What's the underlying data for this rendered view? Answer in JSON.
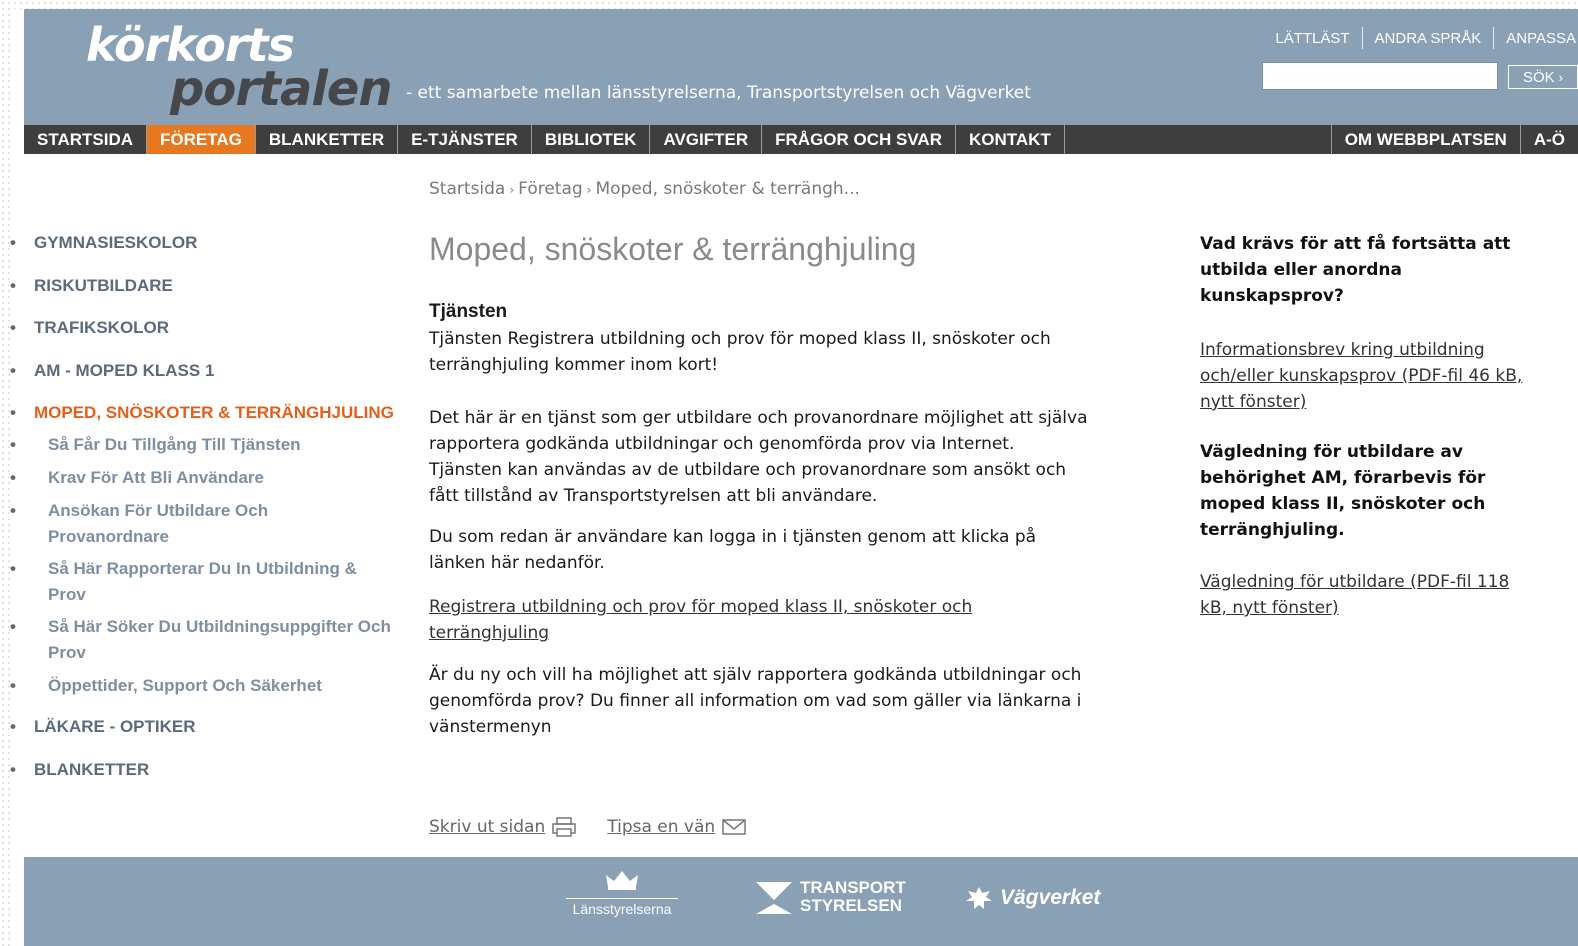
{
  "header": {
    "logo_line1": "körkorts",
    "logo_line2": "portalen",
    "tagline": "- ett samarbete mellan länsstyrelserna, Transportstyrelsen och Vägverket",
    "top_links": [
      "LÄTTLÄST",
      "ANDRA SPRÅK",
      "ANPASSA"
    ],
    "search": {
      "value": "",
      "placeholder": "",
      "button_label": "SÖK"
    }
  },
  "nav": {
    "items": [
      "STARTSIDA",
      "FÖRETAG",
      "BLANKETTER",
      "E-TJÄNSTER",
      "BIBLIOTEK",
      "AVGIFTER",
      "FRÅGOR OCH SVAR",
      "KONTAKT"
    ],
    "active": "FÖRETAG",
    "right_items": [
      "OM WEBBPLATSEN",
      "A-Ö"
    ]
  },
  "breadcrumb": [
    "Startsida",
    "Företag",
    "Moped, snöskoter & terrängh..."
  ],
  "left_menu": {
    "items": [
      "GYMNASIESKOLOR",
      "RISKUTBILDARE",
      "TRAFIKSKOLOR",
      "AM - MOPED KLASS 1",
      "MOPED, SNÖSKOTER & TERRÄNGHJULING"
    ],
    "sub_items": [
      "Så Får Du Tillgång Till Tjänsten",
      "Krav För Att Bli Användare",
      "Ansökan För Utbildare Och",
      "Provanordnare",
      "Så Här Rapporterar Du In Utbildning &",
      "Prov",
      "Så Här Söker Du Utbildningsuppgifter Och",
      "Prov",
      "Öppettider, Support Och Säkerhet"
    ],
    "after_items": [
      "LÄKARE - OPTIKER",
      "BLANKETTER"
    ]
  },
  "main": {
    "title": "Moped, snöskoter & terränghjuling",
    "subheading": "Tjänsten",
    "p1_l1": "Tjänsten Registrera utbildning och prov för moped klass II, snöskoter och",
    "p1_l2": "terränghjuling kommer inom kort!",
    "p2_l1": "Det här är en tjänst som ger utbildare och provanordnare möjlighet att själva",
    "p2_l2": "rapportera godkända utbildningar och genomförda prov via Internet.",
    "p2_l3": "Tjänsten kan användas av de utbildare och provanordnare som ansökt och",
    "p2_l4": "fått tillstånd av Transportstyrelsen att bli användare.",
    "p3_l1": "Du som redan är användare kan logga in i tjänsten genom att klicka på",
    "p3_l2": "länken här nedanför.",
    "link_l1": "Registrera utbildning och prov för moped klass II, snöskoter och",
    "link_l2": "terränghjuling",
    "p4_l1": "Är du ny och vill ha möjlighet att själv rapportera godkända utbildningar och",
    "p4_l2": "genomförda prov? Du finner all information om vad som gäller via länkarna i",
    "p4_l3": "vänstermenyn",
    "print_label": "Skriv ut sidan",
    "tips_label": "Tipsa en vän"
  },
  "right": {
    "h1_l1": "Vad krävs för att få fortsätta att",
    "h1_l2": "utbilda eller anordna",
    "h1_l3": "kunskapsprov?",
    "link1_l1": "Informationsbrev kring utbildning",
    "link1_l2": "och/eller kunskapsprov (PDF-fil 46 kB,",
    "link1_l3": "nytt fönster)",
    "h2_l1": "Vägledning för utbildare av",
    "h2_l2": "behörighet AM, förarbevis för",
    "h2_l3": "moped klass II, snöskoter och",
    "h2_l4": "terränghjuling.",
    "link2_l1": "Vägledning för utbildare (PDF-fil 118",
    "link2_l2": "kB, nytt fönster)"
  },
  "footer": {
    "logo1": "Länsstyrelserna",
    "logo2_l1": "TRANSPORT",
    "logo2_l2": "STYRELSEN",
    "logo3": "Vägverket"
  },
  "colors": {
    "header_bg": "#8aa0b5",
    "nav_bg": "#3e3e3e",
    "accent": "#e8781f",
    "menu_text": "#5b6b7b"
  }
}
